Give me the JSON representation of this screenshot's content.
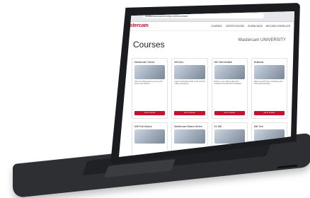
{
  "browser": {
    "url_text": "mastercamuniversity.com/courses"
  },
  "nav": {
    "logo": "Mastercam",
    "items": [
      "COURSES",
      "CERTIFICATIONS",
      "DOWNLOADS",
      "BECOME A RESELLER"
    ]
  },
  "page": {
    "title": "Courses",
    "university_mark": "Mastercam UNIVERSITY"
  },
  "courses": [
    {
      "title": "Mastercam Series",
      "text": "Start your Mastercam journey with these core lessons.",
      "button": "Go to Course"
    },
    {
      "title": "Mill Intro",
      "text": "Learn the fundamentals of 2D and 3D milling operations.",
      "button": "Go to Course"
    },
    {
      "title": "Mill Intermediate",
      "text": "Build on your milling skills with multiaxis and advanced toolpaths.",
      "button": "Go to Course"
    },
    {
      "title": "Multiaxis",
      "text": "Master 4 and 5 axis machining with real-world examples.",
      "button": "Go to Course"
    },
    {
      "title": "Mill Post Basics",
      "text": "",
      "button": ""
    },
    {
      "title": "Mastercam Basics Series",
      "text": "",
      "button": ""
    },
    {
      "title": "5X Mill",
      "text": "",
      "button": ""
    },
    {
      "title": "Mill-Turn",
      "text": "",
      "button": ""
    }
  ],
  "colors": {
    "brand": "#c8102e",
    "device": "#1b1c1f"
  }
}
